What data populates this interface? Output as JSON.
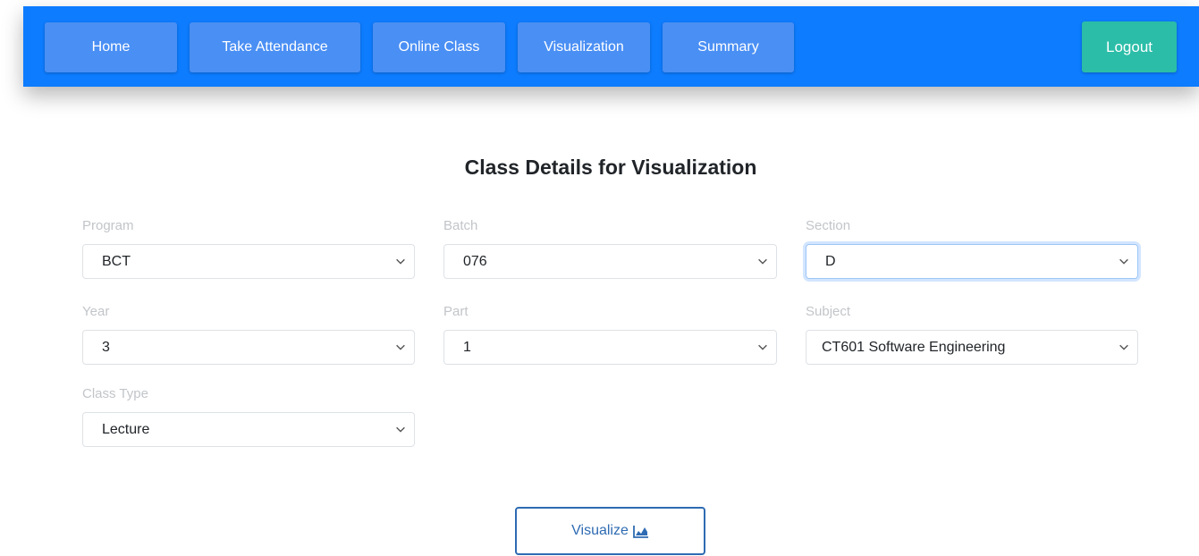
{
  "navbar": {
    "items": [
      {
        "label": "Home"
      },
      {
        "label": "Take Attendance"
      },
      {
        "label": "Online Class"
      },
      {
        "label": "Visualization"
      },
      {
        "label": "Summary"
      }
    ],
    "logout_label": "Logout"
  },
  "main": {
    "title": "Class Details for Visualization",
    "fields": {
      "program": {
        "label": "Program",
        "value": "BCT"
      },
      "batch": {
        "label": "Batch",
        "value": "076"
      },
      "section": {
        "label": "Section",
        "value": "D"
      },
      "year": {
        "label": "Year",
        "value": "3"
      },
      "part": {
        "label": "Part",
        "value": "1"
      },
      "subject": {
        "label": "Subject",
        "value": "CT601 Software Engineering"
      },
      "class_type": {
        "label": "Class Type",
        "value": "Lecture"
      }
    },
    "visualize_label": "Visualize",
    "visualize_icon": "area-chart-icon"
  },
  "colors": {
    "navbar": "#0d7cff",
    "nav_button": "#4a8ff4",
    "logout": "#2bbda8",
    "visualize_border": "#2e6bb3"
  }
}
